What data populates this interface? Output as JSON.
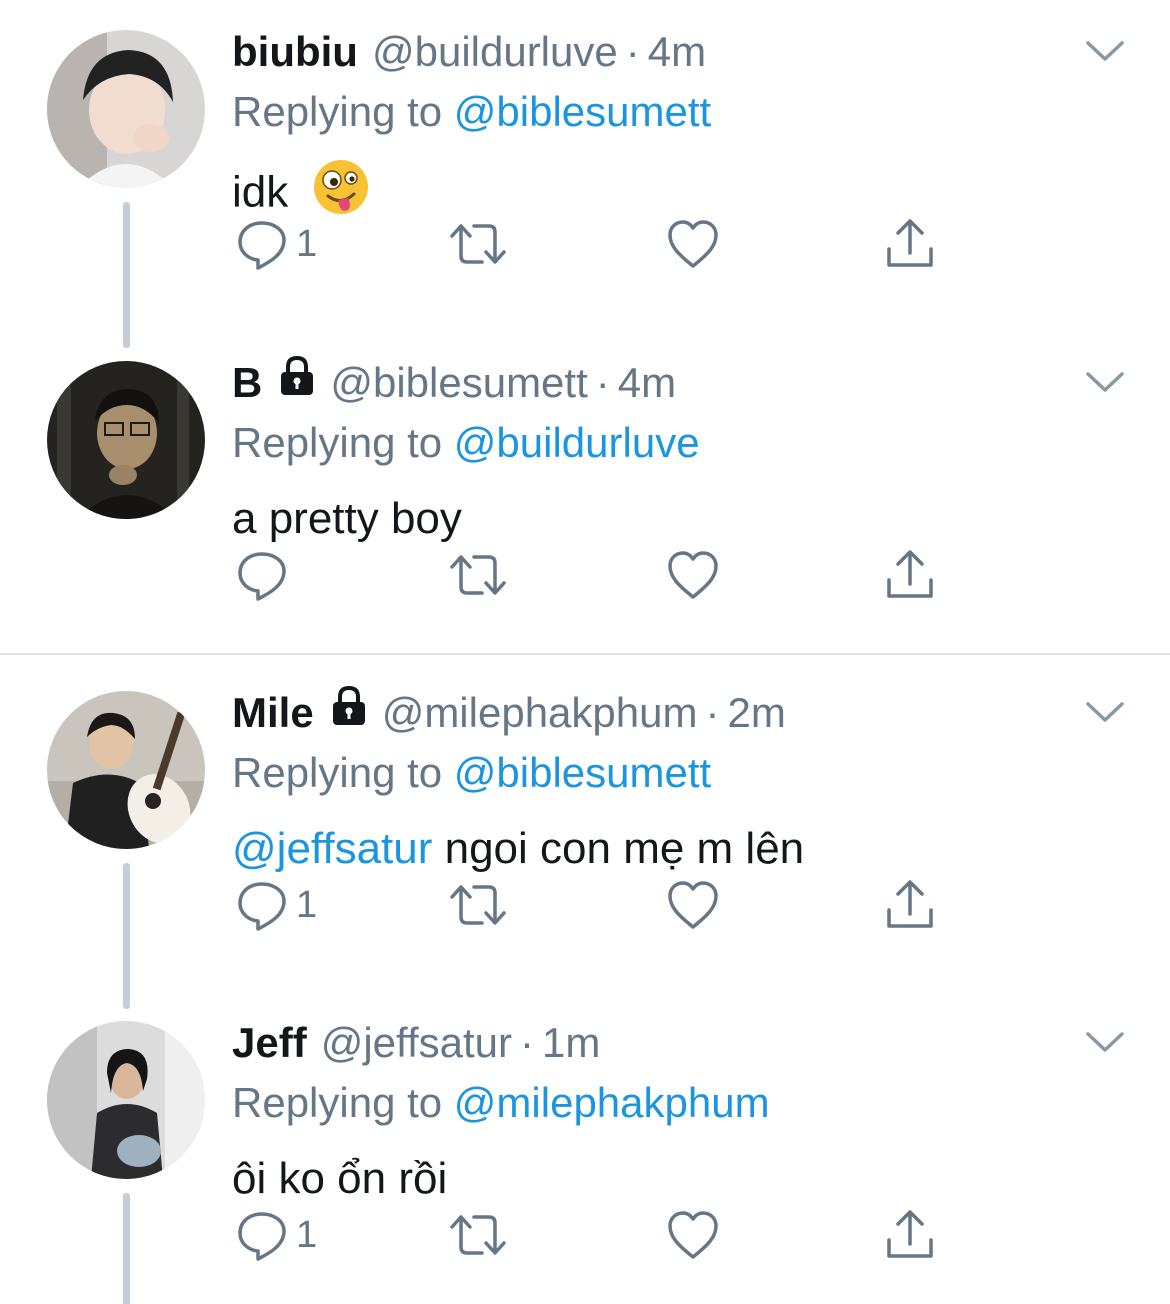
{
  "tweets": [
    {
      "name": "biubiu",
      "handle": "@buildurluve",
      "time": "4m",
      "replying_label": "Replying to",
      "replying_to": "@biblesumett",
      "text": "idk",
      "emoji": "🤪",
      "reply_count": "1",
      "locked": false
    },
    {
      "name": "B",
      "handle": "@biblesumett",
      "time": "4m",
      "replying_label": "Replying to",
      "replying_to": "@buildurluve",
      "text": "a pretty boy",
      "reply_count": "",
      "locked": true
    },
    {
      "name": "Mile",
      "handle": "@milephakphum",
      "time": "2m",
      "replying_label": "Replying to",
      "replying_to": "@biblesumett",
      "mention": "@jeffsatur",
      "text": " ngoi con mẹ m lên",
      "reply_count": "1",
      "locked": true
    },
    {
      "name": "Jeff",
      "handle": "@jeffsatur",
      "time": "1m",
      "replying_label": "Replying to",
      "replying_to": "@milephakphum",
      "text": "ôi ko ổn rồi",
      "reply_count": "1",
      "locked": false
    }
  ],
  "separator": "·",
  "icons": [
    "reply-icon",
    "retweet-icon",
    "like-icon",
    "share-icon",
    "chevron-down-icon",
    "lock-icon"
  ],
  "colors": {
    "link": "#1b95e0",
    "secondary": "#657786",
    "text": "#14171a",
    "icon": "#657786"
  }
}
